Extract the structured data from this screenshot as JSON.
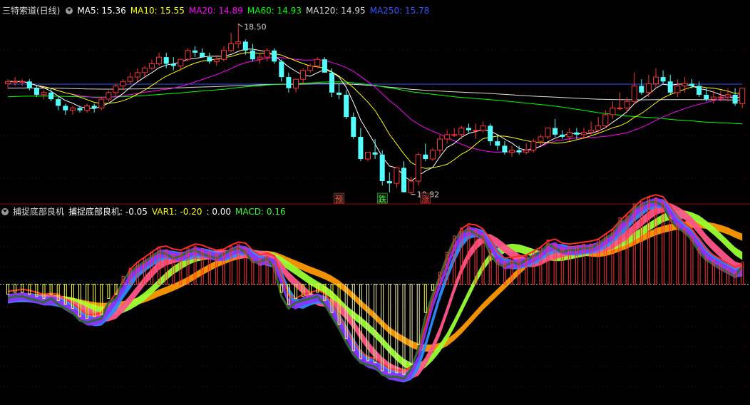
{
  "header": {
    "title": "三特索道(日线)",
    "ma": [
      {
        "label": "MA5: 15.36",
        "color": "#ffffff"
      },
      {
        "label": "MA10: 15.55",
        "color": "#ffff00"
      },
      {
        "label": "MA20: 14.89",
        "color": "#ff00ff"
      },
      {
        "label": "MA60: 14.93",
        "color": "#00ff00"
      },
      {
        "label": "MA120: 14.95",
        "color": "#dddddd"
      },
      {
        "label": "MA250: 15.78",
        "color": "#3355ff"
      }
    ]
  },
  "indicator_header": {
    "name": "捕捉底部良机",
    "values": [
      {
        "label": "捕捉底部良机: -0.05",
        "color": "#ffffff"
      },
      {
        "label": "VAR1: -0.20",
        "color": "#ffff00"
      },
      {
        "label": ": 0.00",
        "color": "#ffffff"
      },
      {
        "label": "MACD: 0.16",
        "color": "#33ff33"
      }
    ]
  },
  "markers": [
    {
      "text": "预",
      "color": "#ff5533",
      "bar": 47
    },
    {
      "text": "跌",
      "color": "#33ff33",
      "bar": 53
    },
    {
      "text": "涨",
      "color": "#ff3333",
      "bar": 59
    }
  ],
  "annotations": [
    {
      "text": "18.50",
      "bar": 33
    },
    {
      "text": "10.82",
      "bar": 57
    }
  ],
  "chart_data": [
    {
      "type": "candlestick",
      "x": [
        1,
        2,
        3,
        4,
        5,
        6,
        7,
        8,
        9,
        10,
        11,
        12,
        13,
        14,
        15,
        16,
        17,
        18,
        19,
        20,
        21,
        22,
        23,
        24,
        25,
        26,
        27,
        28,
        29,
        30,
        31,
        32,
        33,
        34,
        35,
        36,
        37,
        38,
        39,
        40,
        41,
        42,
        43,
        44,
        45,
        46,
        47,
        48,
        49,
        50,
        51,
        52,
        53,
        54,
        55,
        56,
        57,
        58,
        59,
        60,
        61,
        62,
        63,
        64,
        65,
        66,
        67,
        68,
        69,
        70,
        71,
        72,
        73,
        74,
        75,
        76,
        77,
        78,
        79,
        80,
        81,
        82,
        83,
        84,
        85,
        86,
        87,
        88,
        89,
        90,
        91,
        92,
        93,
        94,
        95,
        96,
        97,
        98,
        99,
        100,
        101,
        102,
        103
      ],
      "open": [
        15.8,
        15.9,
        15.9,
        15.9,
        15.6,
        15.3,
        15.4,
        15.1,
        14.8,
        14.6,
        14.7,
        14.6,
        14.8,
        14.7,
        15.1,
        15.4,
        15.7,
        15.9,
        16.1,
        16.3,
        16.5,
        16.7,
        17.0,
        16.7,
        16.6,
        16.9,
        17.3,
        17.2,
        17.0,
        16.8,
        16.9,
        17.3,
        17.6,
        17.7,
        17.3,
        16.9,
        17.0,
        17.3,
        16.8,
        16.1,
        15.6,
        16.0,
        16.4,
        16.6,
        16.9,
        16.3,
        15.4,
        15.3,
        14.3,
        13.4,
        12.4,
        12.7,
        12.6,
        11.4,
        11.3,
        12.0,
        10.9,
        11.4,
        12.6,
        12.4,
        12.8,
        13.3,
        13.5,
        13.5,
        13.8,
        13.7,
        13.7,
        13.9,
        13.2,
        13.0,
        12.7,
        12.8,
        12.7,
        12.8,
        13.2,
        13.4,
        13.8,
        13.5,
        13.4,
        13.6,
        13.5,
        13.6,
        13.7,
        13.9,
        14.4,
        14.7,
        14.7,
        15.0,
        15.7,
        15.4,
        15.8,
        16.1,
        15.9,
        15.4,
        15.7,
        15.8,
        15.7,
        15.3,
        15.1,
        15.2,
        15.2,
        15.3,
        14.9
      ],
      "high": [
        16.0,
        16.1,
        16.0,
        16.0,
        15.7,
        15.5,
        15.6,
        15.2,
        14.9,
        14.8,
        14.8,
        14.9,
        14.9,
        15.2,
        15.5,
        15.8,
        16.0,
        16.3,
        16.5,
        16.6,
        16.9,
        17.2,
        17.2,
        17.0,
        16.9,
        17.4,
        17.5,
        17.4,
        17.2,
        17.1,
        17.5,
        18.1,
        18.5,
        17.8,
        17.6,
        17.2,
        17.4,
        17.4,
        16.9,
        16.3,
        16.0,
        16.5,
        16.7,
        17.0,
        17.0,
        16.5,
        15.8,
        15.5,
        14.5,
        13.8,
        12.7,
        13.3,
        12.8,
        11.8,
        11.7,
        12.3,
        11.6,
        12.7,
        13.1,
        12.9,
        13.5,
        13.7,
        13.8,
        13.9,
        14.0,
        14.0,
        14.1,
        14.0,
        13.5,
        13.2,
        13.0,
        13.0,
        13.1,
        13.3,
        13.5,
        13.8,
        14.2,
        13.7,
        13.8,
        13.8,
        13.8,
        14.1,
        14.3,
        14.6,
        15.0,
        15.4,
        15.2,
        16.3,
        16.0,
        16.2,
        16.5,
        16.4,
        16.2,
        16.0,
        16.1,
        16.0,
        15.9,
        15.6,
        15.5,
        15.5,
        15.6,
        15.6,
        15.0
      ],
      "low": [
        15.6,
        15.7,
        15.7,
        15.5,
        15.2,
        15.1,
        15.0,
        14.6,
        14.4,
        14.4,
        14.5,
        14.5,
        14.5,
        14.6,
        15.0,
        15.2,
        15.5,
        15.8,
        15.9,
        16.1,
        16.4,
        16.6,
        16.5,
        16.4,
        16.4,
        16.8,
        17.0,
        17.0,
        16.7,
        16.6,
        16.8,
        17.2,
        17.4,
        17.1,
        16.8,
        16.7,
        16.8,
        16.7,
        15.9,
        15.4,
        15.4,
        15.8,
        16.3,
        16.5,
        16.3,
        15.2,
        15.1,
        14.2,
        13.3,
        12.3,
        12.3,
        12.4,
        11.2,
        10.9,
        11.1,
        10.9,
        10.8,
        11.2,
        12.3,
        12.3,
        12.6,
        13.1,
        13.4,
        13.3,
        13.6,
        13.3,
        13.6,
        13.0,
        12.8,
        12.6,
        12.5,
        12.6,
        12.6,
        12.7,
        13.0,
        13.3,
        13.4,
        13.3,
        13.2,
        13.3,
        13.3,
        13.5,
        13.6,
        13.8,
        14.2,
        14.6,
        14.5,
        14.9,
        15.3,
        15.2,
        15.6,
        15.8,
        15.3,
        15.2,
        15.4,
        15.6,
        15.2,
        15.0,
        14.9,
        15.0,
        15.0,
        14.8,
        14.7
      ],
      "close": [
        15.9,
        15.9,
        15.9,
        15.6,
        15.3,
        15.4,
        15.1,
        14.8,
        14.6,
        14.7,
        14.6,
        14.8,
        14.7,
        15.1,
        15.4,
        15.7,
        15.9,
        16.1,
        16.3,
        16.5,
        16.7,
        17.0,
        16.7,
        16.6,
        16.9,
        17.3,
        17.2,
        17.0,
        16.8,
        16.9,
        17.3,
        17.6,
        17.7,
        17.3,
        16.9,
        17.0,
        17.3,
        16.8,
        16.1,
        15.6,
        16.0,
        16.4,
        16.6,
        16.9,
        16.3,
        15.4,
        15.3,
        14.3,
        13.4,
        12.4,
        12.7,
        12.6,
        11.4,
        11.3,
        12.0,
        10.9,
        11.4,
        12.6,
        12.4,
        12.8,
        13.3,
        13.5,
        13.5,
        13.8,
        13.7,
        13.7,
        13.9,
        13.2,
        13.0,
        12.7,
        12.8,
        12.7,
        12.8,
        13.2,
        13.4,
        13.8,
        13.5,
        13.4,
        13.6,
        13.5,
        13.6,
        13.7,
        13.9,
        14.4,
        14.7,
        14.7,
        15.0,
        15.7,
        15.4,
        15.8,
        16.1,
        15.9,
        15.4,
        15.7,
        15.8,
        15.7,
        15.3,
        15.1,
        15.2,
        15.2,
        15.3,
        14.9,
        15.6
      ],
      "ylim": [
        10.5,
        19.0
      ]
    },
    {
      "type": "bar",
      "name": "捕捉底部良机",
      "x": [
        1,
        2,
        3,
        4,
        5,
        6,
        7,
        8,
        9,
        10,
        11,
        12,
        13,
        14,
        15,
        16,
        17,
        18,
        19,
        20,
        21,
        22,
        23,
        24,
        25,
        26,
        27,
        28,
        29,
        30,
        31,
        32,
        33,
        34,
        35,
        36,
        37,
        38,
        39,
        40,
        41,
        42,
        43,
        44,
        45,
        46,
        47,
        48,
        49,
        50,
        51,
        52,
        53,
        54,
        55,
        56,
        57,
        58,
        59,
        60,
        61,
        62,
        63,
        64,
        65,
        66,
        67,
        68,
        69,
        70,
        71,
        72,
        73,
        74,
        75,
        76,
        77,
        78,
        79,
        80,
        81,
        82,
        83,
        84,
        85,
        86,
        87,
        88,
        89,
        90,
        91,
        92,
        93,
        94,
        95,
        96,
        97,
        98,
        99,
        100,
        101,
        102,
        103
      ],
      "values": [
        -0.5,
        -0.4,
        -0.4,
        -0.5,
        -0.6,
        -0.7,
        -0.5,
        -0.8,
        -1.0,
        -1.2,
        -1.6,
        -1.7,
        -1.6,
        -1.5,
        -0.7,
        -0.5,
        0.4,
        0.8,
        1.1,
        1.3,
        1.6,
        1.8,
        1.7,
        1.5,
        1.6,
        1.8,
        1.9,
        1.7,
        1.6,
        1.5,
        1.7,
        1.9,
        2.0,
        1.8,
        1.3,
        1.3,
        1.5,
        1.0,
        -0.4,
        -1.0,
        -0.7,
        -0.6,
        -0.5,
        -0.4,
        -0.8,
        -1.4,
        -2.0,
        -2.7,
        -3.3,
        -3.7,
        -3.8,
        -3.9,
        -4.3,
        -4.4,
        -4.4,
        -4.5,
        -4.0,
        -3.0,
        -1.4,
        -0.3,
        0.6,
        1.6,
        2.4,
        2.8,
        2.9,
        2.7,
        2.5,
        1.7,
        1.2,
        1.1,
        1.3,
        1.2,
        1.4,
        1.6,
        1.8,
        2.2,
        2.0,
        1.8,
        1.9,
        1.9,
        2.0,
        2.0,
        2.2,
        2.5,
        2.7,
        3.3,
        3.4,
        4.0,
        4.1,
        4.3,
        4.3,
        4.1,
        3.4,
        3.0,
        2.8,
        2.4,
        1.8,
        1.4,
        1.2,
        1.0,
        0.8,
        0.6,
        1.1
      ],
      "ylim": [
        -6,
        3.5
      ]
    }
  ]
}
